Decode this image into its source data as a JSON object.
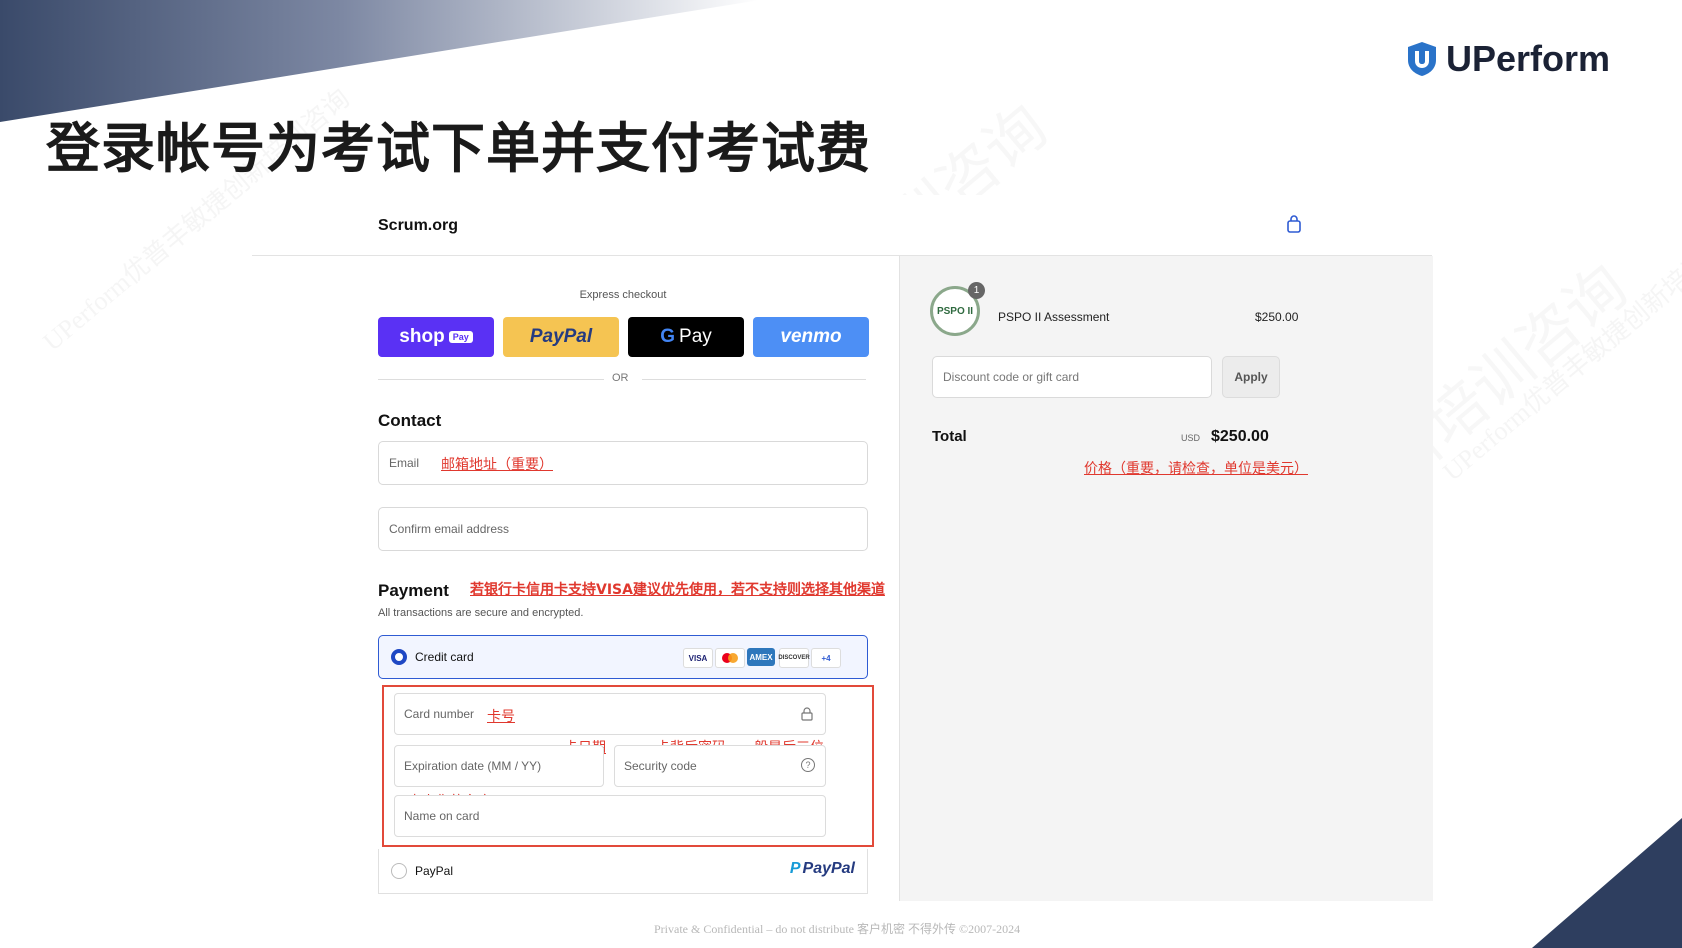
{
  "slide": {
    "title": "登录帐号为考试下单并支付考试费",
    "logo_text": "UPerform",
    "footer": "Private & Confidential – do not distribute 客户机密 不得外传 ©2007-2024",
    "watermark": "UPerform优普丰敏捷创新培训咨询"
  },
  "checkout": {
    "brand": "Scrum.org",
    "express_label": "Express checkout",
    "buttons": {
      "shop": "shop",
      "shop_badge": "Pay",
      "paypal": "PayPal",
      "gpay": "Pay",
      "venmo": "venmo"
    },
    "or": "OR",
    "contact": {
      "heading": "Contact",
      "email_label": "Email",
      "email_note": "邮箱地址（重要）",
      "confirm_label": "Confirm email address"
    },
    "payment": {
      "heading": "Payment",
      "note": "若银行卡信用卡支持VISA建议优先使用，若不支持则选择其他渠道",
      "subtext": "All transactions are secure and encrypted.",
      "credit_card_label": "Credit card",
      "card_brands": [
        "VISA",
        "MC",
        "AMEX",
        "DISCOVER"
      ],
      "more_brands": "+4",
      "card_number_label": "Card number",
      "card_number_note": "卡号",
      "expiry_note": "卡日期",
      "cvv_note": "卡背后密码，一般是后三位",
      "expiry_label": "Expiration date (MM / YY)",
      "security_label": "Security code",
      "name_note": "卡上你的名字",
      "name_label": "Name on card",
      "paypal_label": "PayPal",
      "paypal_logo": "PayPal"
    },
    "summary": {
      "product_badge": "PSPO II",
      "quantity": "1",
      "product_name": "PSPO II Assessment",
      "product_price": "$250.00",
      "discount_placeholder": "Discount code or gift card",
      "apply_label": "Apply",
      "total_label": "Total",
      "currency": "USD",
      "total_value": "$250.00",
      "total_note": "价格（重要，请检查，单位是美元）"
    }
  },
  "colors": {
    "annotation": "#e0382e",
    "shop": "#5a31f4",
    "paypal_yellow": "#f5c452",
    "venmo": "#4d8ff5",
    "navy": "#2c3a58"
  }
}
